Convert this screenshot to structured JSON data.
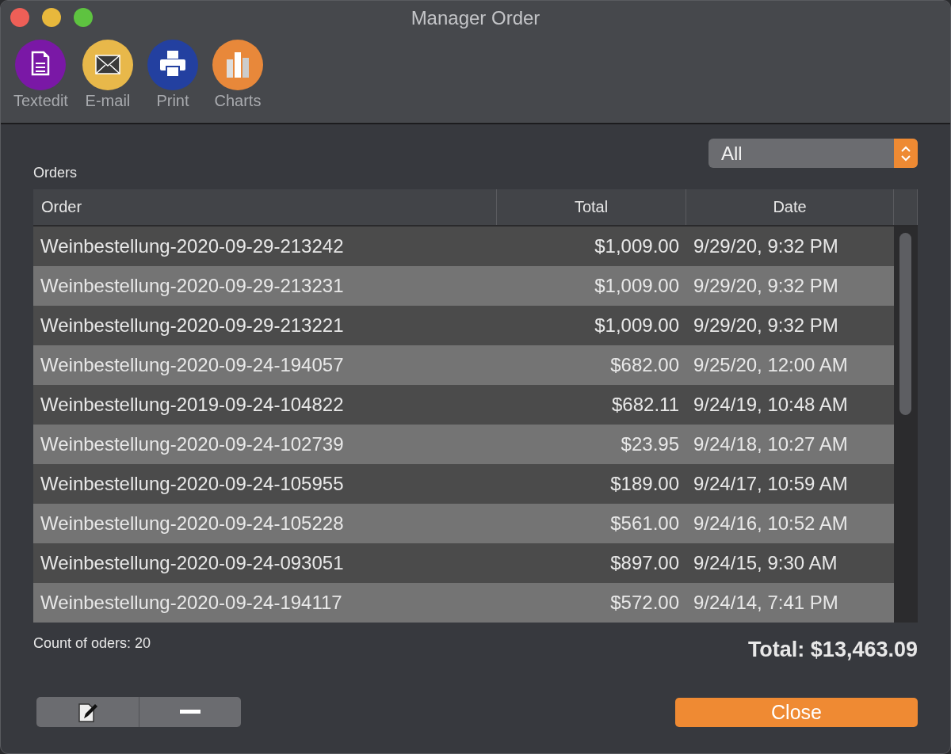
{
  "window": {
    "title": "Manager Order"
  },
  "toolbar": [
    {
      "label": "Textedit",
      "kind": "document"
    },
    {
      "label": "E-mail",
      "kind": "mail"
    },
    {
      "label": "Print",
      "kind": "print"
    },
    {
      "label": "Charts",
      "kind": "chart"
    }
  ],
  "filter": {
    "value": "All"
  },
  "orders_label": "Orders",
  "table": {
    "columns": [
      "Order",
      "Total",
      "Date"
    ],
    "rows": [
      [
        "Weinbestellung-2020-09-29-213242",
        "$1,009.00",
        "9/29/20, 9:32 PM"
      ],
      [
        "Weinbestellung-2020-09-29-213231",
        "$1,009.00",
        "9/29/20, 9:32 PM"
      ],
      [
        "Weinbestellung-2020-09-29-213221",
        "$1,009.00",
        "9/29/20, 9:32 PM"
      ],
      [
        "Weinbestellung-2020-09-24-194057",
        "$682.00",
        "9/25/20, 12:00 AM"
      ],
      [
        "Weinbestellung-2019-09-24-104822",
        "$682.11",
        "9/24/19, 10:48 AM"
      ],
      [
        "Weinbestellung-2020-09-24-102739",
        "$23.95",
        "9/24/18, 10:27 AM"
      ],
      [
        "Weinbestellung-2020-09-24-105955",
        "$189.00",
        "9/24/17, 10:59 AM"
      ],
      [
        "Weinbestellung-2020-09-24-105228",
        "$561.00",
        "9/24/16, 10:52 AM"
      ],
      [
        "Weinbestellung-2020-09-24-093051",
        "$897.00",
        "9/24/15, 9:30 AM"
      ],
      [
        "Weinbestellung-2020-09-24-194117",
        "$572.00",
        "9/24/14, 7:41 PM"
      ]
    ]
  },
  "count": "Count of oders: 20",
  "total": "Total: $13,463.09",
  "close_button": "Close"
}
